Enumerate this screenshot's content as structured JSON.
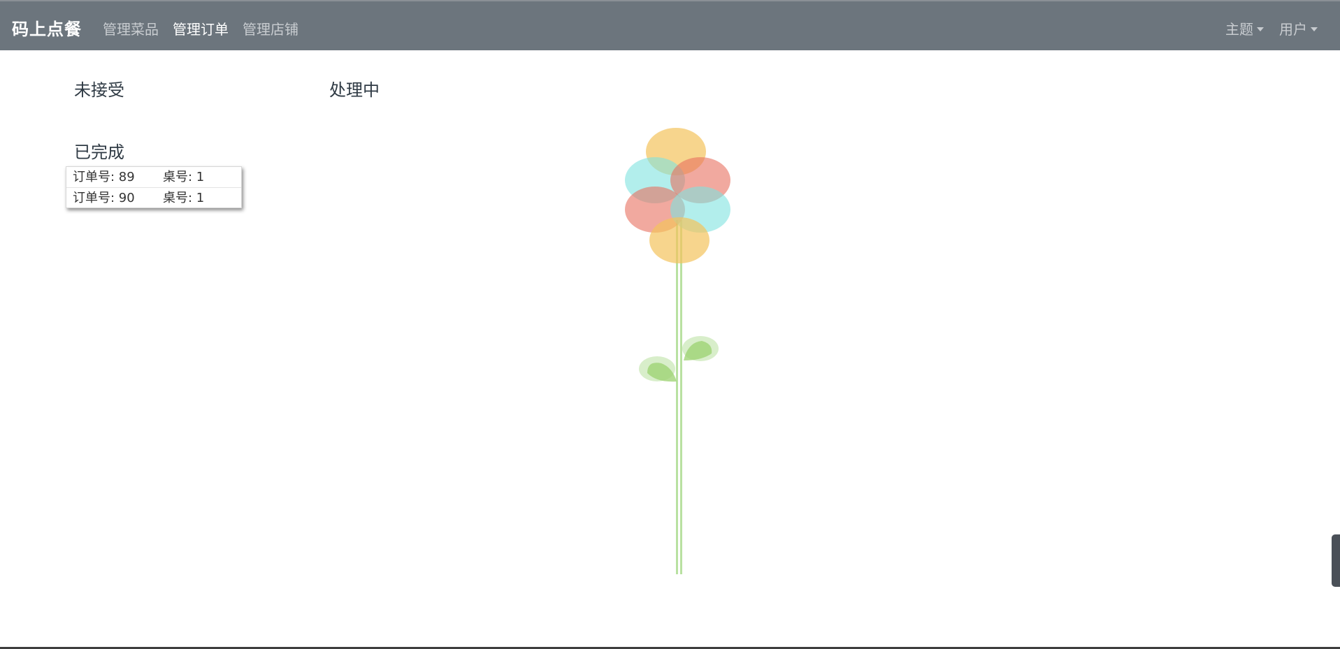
{
  "navbar": {
    "brand": "码上点餐",
    "links": [
      {
        "label": "管理菜品",
        "active": false
      },
      {
        "label": "管理订单",
        "active": true
      },
      {
        "label": "管理店铺",
        "active": false
      }
    ],
    "theme_label": "主题",
    "user_label": "用户"
  },
  "sections": {
    "pending": "未接受",
    "processing": "处理中",
    "completed": "已完成"
  },
  "completed_orders": [
    {
      "order": "订单号: 89",
      "table": "桌号: 1"
    },
    {
      "order": "订单号: 90",
      "table": "桌号: 1"
    }
  ],
  "colors": {
    "navbar_bg": "#6c757d",
    "petal_yellow": "#f3c35c",
    "petal_teal": "#7fe3e0",
    "petal_red": "#e8705f",
    "stem_green": "#a8d98a"
  }
}
